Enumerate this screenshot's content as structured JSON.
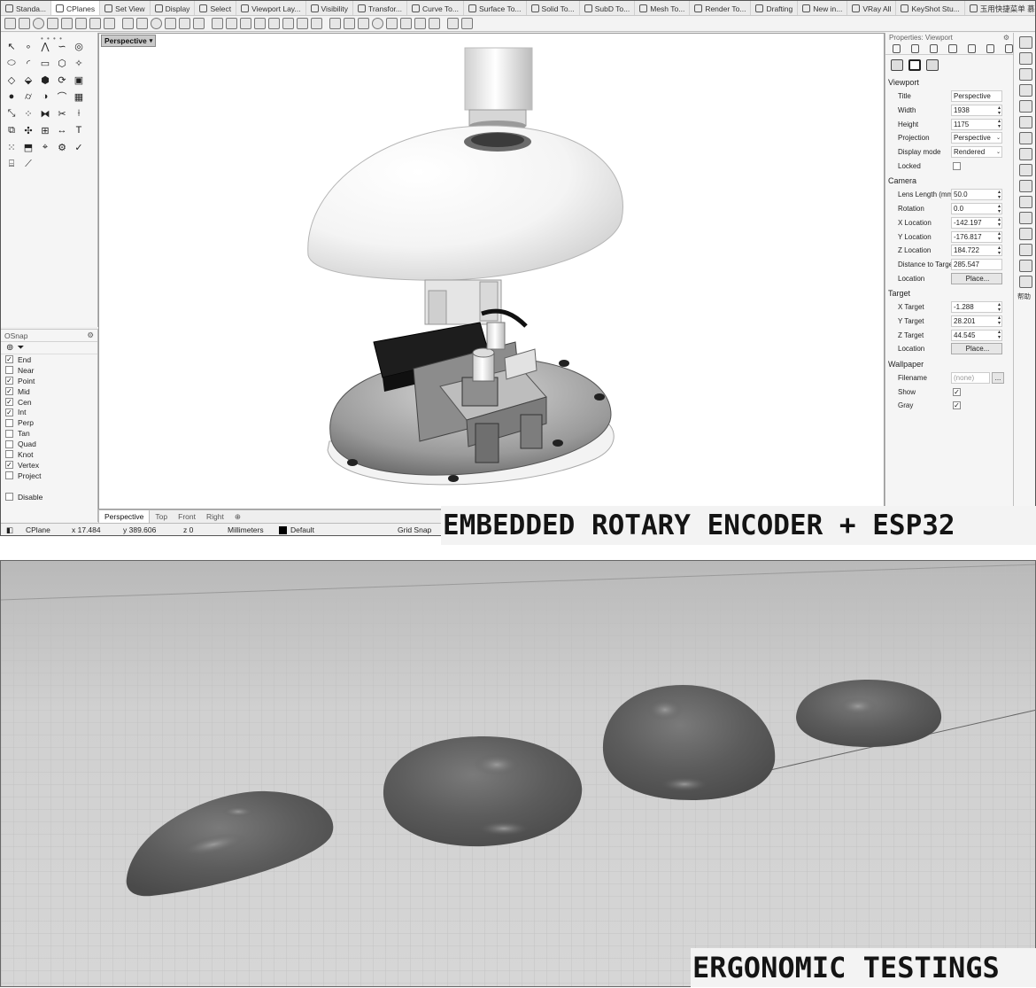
{
  "toolbar_tabs": [
    "Standa...",
    "CPlanes",
    "Set View",
    "Display",
    "Select",
    "Viewport Lay...",
    "Visibility",
    "Transfor...",
    "Curve To...",
    "Surface To...",
    "Solid To...",
    "SubD To...",
    "Mesh To...",
    "Render To...",
    "Drafting",
    "New in...",
    "VRay All",
    "KeyShot Stu...",
    "玉用快捷菜单 慕惜..."
  ],
  "active_tab": "CPlanes",
  "viewport": {
    "label": "Perspective",
    "tabs": [
      "Perspective",
      "Top",
      "Front",
      "Right"
    ]
  },
  "osnap": {
    "title": "OSnap",
    "items": [
      {
        "label": "End",
        "checked": true
      },
      {
        "label": "Near",
        "checked": false
      },
      {
        "label": "Point",
        "checked": true
      },
      {
        "label": "Mid",
        "checked": true
      },
      {
        "label": "Cen",
        "checked": true
      },
      {
        "label": "Int",
        "checked": true
      },
      {
        "label": "Perp",
        "checked": false
      },
      {
        "label": "Tan",
        "checked": false
      },
      {
        "label": "Quad",
        "checked": false
      },
      {
        "label": "Knot",
        "checked": false
      },
      {
        "label": "Vertex",
        "checked": true
      },
      {
        "label": "Project",
        "checked": false
      }
    ],
    "disable_label": "Disable"
  },
  "properties": {
    "title": "Properties: Viewport",
    "viewport_section": "Viewport",
    "title_label": "Title",
    "title_value": "Perspective",
    "width_label": "Width",
    "width_value": "1938",
    "height_label": "Height",
    "height_value": "1175",
    "projection_label": "Projection",
    "projection_value": "Perspective",
    "display_mode_label": "Display mode",
    "display_mode_value": "Rendered",
    "locked_label": "Locked",
    "camera_section": "Camera",
    "lens_label": "Lens Length (mm)",
    "lens_value": "50.0",
    "rotation_label": "Rotation",
    "rotation_value": "0.0",
    "xloc_label": "X Location",
    "xloc_value": "-142.197",
    "yloc_label": "Y Location",
    "yloc_value": "-176.817",
    "zloc_label": "Z Location",
    "zloc_value": "184.722",
    "dist_label": "Distance to Target",
    "dist_value": "285.547",
    "cam_location_label": "Location",
    "place_label": "Place...",
    "target_section": "Target",
    "xtarget_label": "X Target",
    "xtarget_value": "-1.288",
    "ytarget_label": "Y Target",
    "ytarget_value": "28.201",
    "ztarget_label": "Z Target",
    "ztarget_value": "44.545",
    "target_location_label": "Location",
    "wallpaper_section": "Wallpaper",
    "filename_label": "Filename",
    "filename_value": "(none)",
    "browse_label": "...",
    "show_label": "Show",
    "gray_label": "Gray"
  },
  "right_strip_label": "帮助",
  "status": {
    "cplane": "CPlane",
    "x": "x 17.484",
    "y": "y 389.606",
    "z": "z 0",
    "units": "Millimeters",
    "layer": "Default",
    "grid_snap": "Grid Snap"
  },
  "captions": {
    "top": "EMBEDDED ROTARY ENCODER + ESP32",
    "bottom": "ERGONOMIC TESTINGS"
  },
  "icons": {
    "osnap_settings": "⚙",
    "osnap_filter": "⊚",
    "dropdown": "▾",
    "check": "✓",
    "spin": "▲▼",
    "add_tab": "⊕"
  }
}
